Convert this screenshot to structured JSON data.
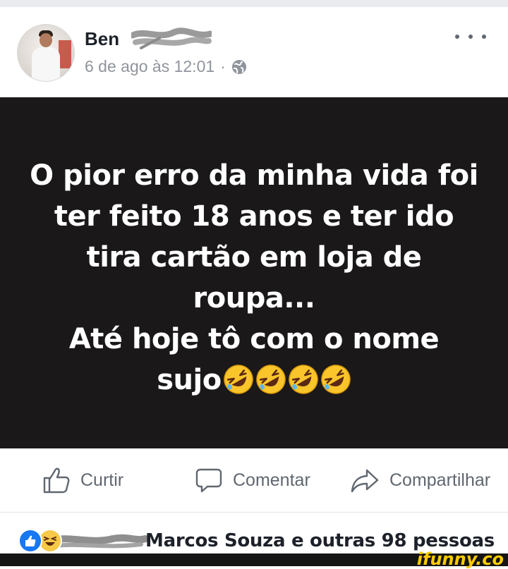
{
  "header": {
    "name": "Ben",
    "timestamp": "6 de ago às 12:01",
    "separator": "·",
    "privacy_icon": "globe-icon",
    "menu_icon": "more-dots-icon"
  },
  "post": {
    "lines": [
      "O pior erro da minha vida foi",
      "ter feito 18 anos e ter ido",
      "tira cartão em loja de",
      "roupa...",
      "Até hoje tô com o nome",
      "sujo"
    ],
    "emoji_icon": "rolling-on-floor-laughing-emoji",
    "emoji_count": 4,
    "background": "#1a1818"
  },
  "actions": {
    "like_label": "Curtir",
    "comment_label": "Comentar",
    "share_label": "Compartilhar"
  },
  "reactions": {
    "icons": [
      "like-reaction-icon",
      "haha-reaction-icon"
    ],
    "text": "Marcos Souza e outras 98 pessoas"
  },
  "watermark": "ifunny.co"
}
